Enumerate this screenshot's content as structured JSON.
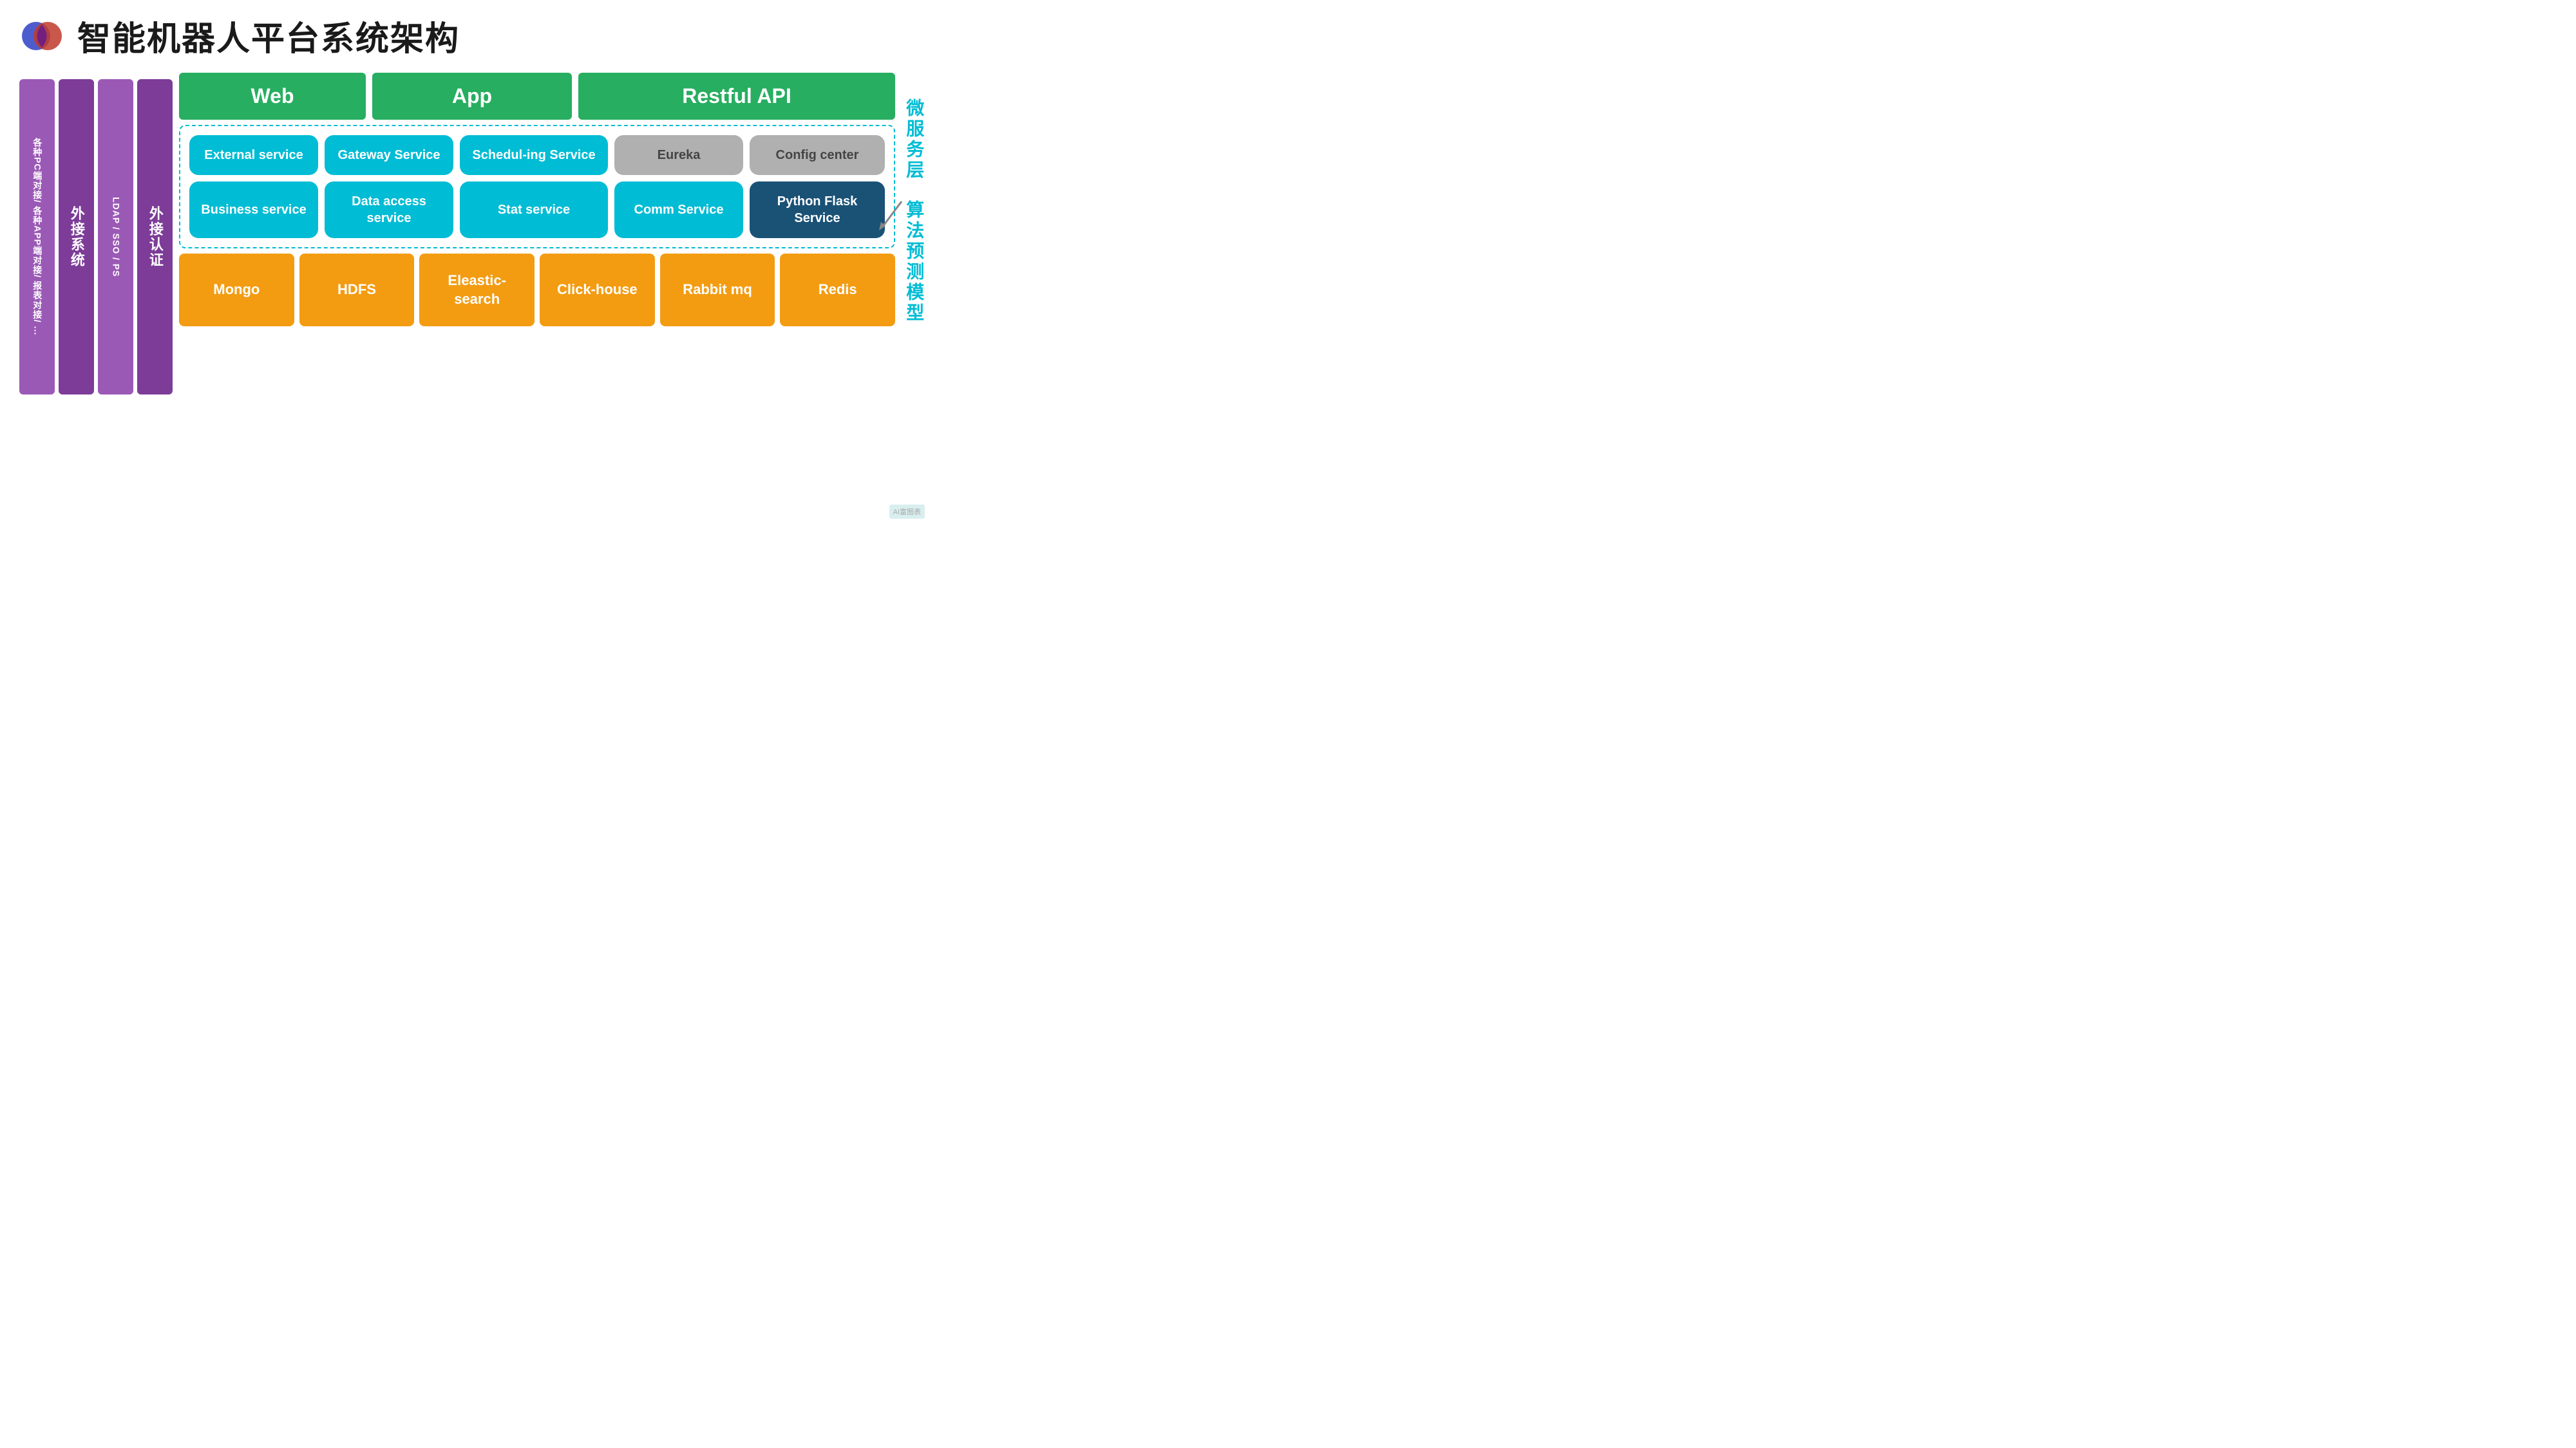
{
  "header": {
    "title": "智能机器人平台系统架构"
  },
  "sidebar_left": {
    "box1_text": "各种PC端对接/ 各种APP端对接/ 报表对接/ ...",
    "box2_text": "外接系统",
    "box3_text": "LDAP / SSO / PS",
    "box4_text": "外接认证"
  },
  "top_headers": [
    {
      "label": "Web"
    },
    {
      "label": "App"
    },
    {
      "label": "Restful API"
    }
  ],
  "services_row1": [
    {
      "label": "External service",
      "type": "cyan"
    },
    {
      "label": "Gateway Service",
      "type": "cyan"
    },
    {
      "label": "Schedul-ing Service",
      "type": "cyan"
    },
    {
      "label": "Eureka",
      "type": "gray"
    },
    {
      "label": "Config center",
      "type": "gray"
    }
  ],
  "services_row2": [
    {
      "label": "Business service",
      "type": "cyan"
    },
    {
      "label": "Data access service",
      "type": "cyan"
    },
    {
      "label": "Stat service",
      "type": "cyan"
    },
    {
      "label": "Comm Service",
      "type": "cyan"
    },
    {
      "label": "Python Flask Service",
      "type": "dark-blue"
    }
  ],
  "bottom_boxes": [
    {
      "label": "Mongo"
    },
    {
      "label": "HDFS"
    },
    {
      "label": "Eleastic-search"
    },
    {
      "label": "Click-house"
    },
    {
      "label": "Rabbit mq"
    },
    {
      "label": "Redis"
    }
  ],
  "right_labels": [
    {
      "text": "微服务层"
    },
    {
      "text": "算法预测模型"
    }
  ],
  "watermark": "AI富图表"
}
